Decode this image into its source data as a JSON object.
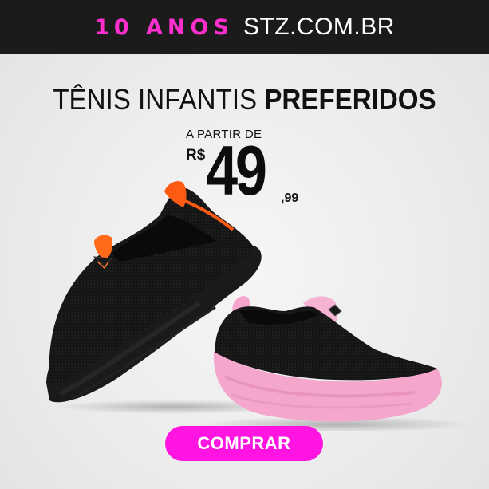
{
  "banner": {
    "years_text": "10 ANOS",
    "site_text": "STZ.COM.BR"
  },
  "headline": {
    "light_part": "TÊNIS INFANTIS",
    "bold_part": "PREFERIDOS"
  },
  "price": {
    "from_label": "A PARTIR DE",
    "currency": "R$",
    "integer": "49",
    "cents": ",99"
  },
  "cta": {
    "label": "COMPRAR"
  },
  "colors": {
    "accent_pink": "#ff14e1",
    "banner_bg": "#1b1b1b",
    "shoe_black": "#141414",
    "sole_pink": "#f4a6cc",
    "trim_orange": "#ff5a14"
  },
  "icons": {
    "product_image": "kids-slip-on-sneakers-pair"
  }
}
